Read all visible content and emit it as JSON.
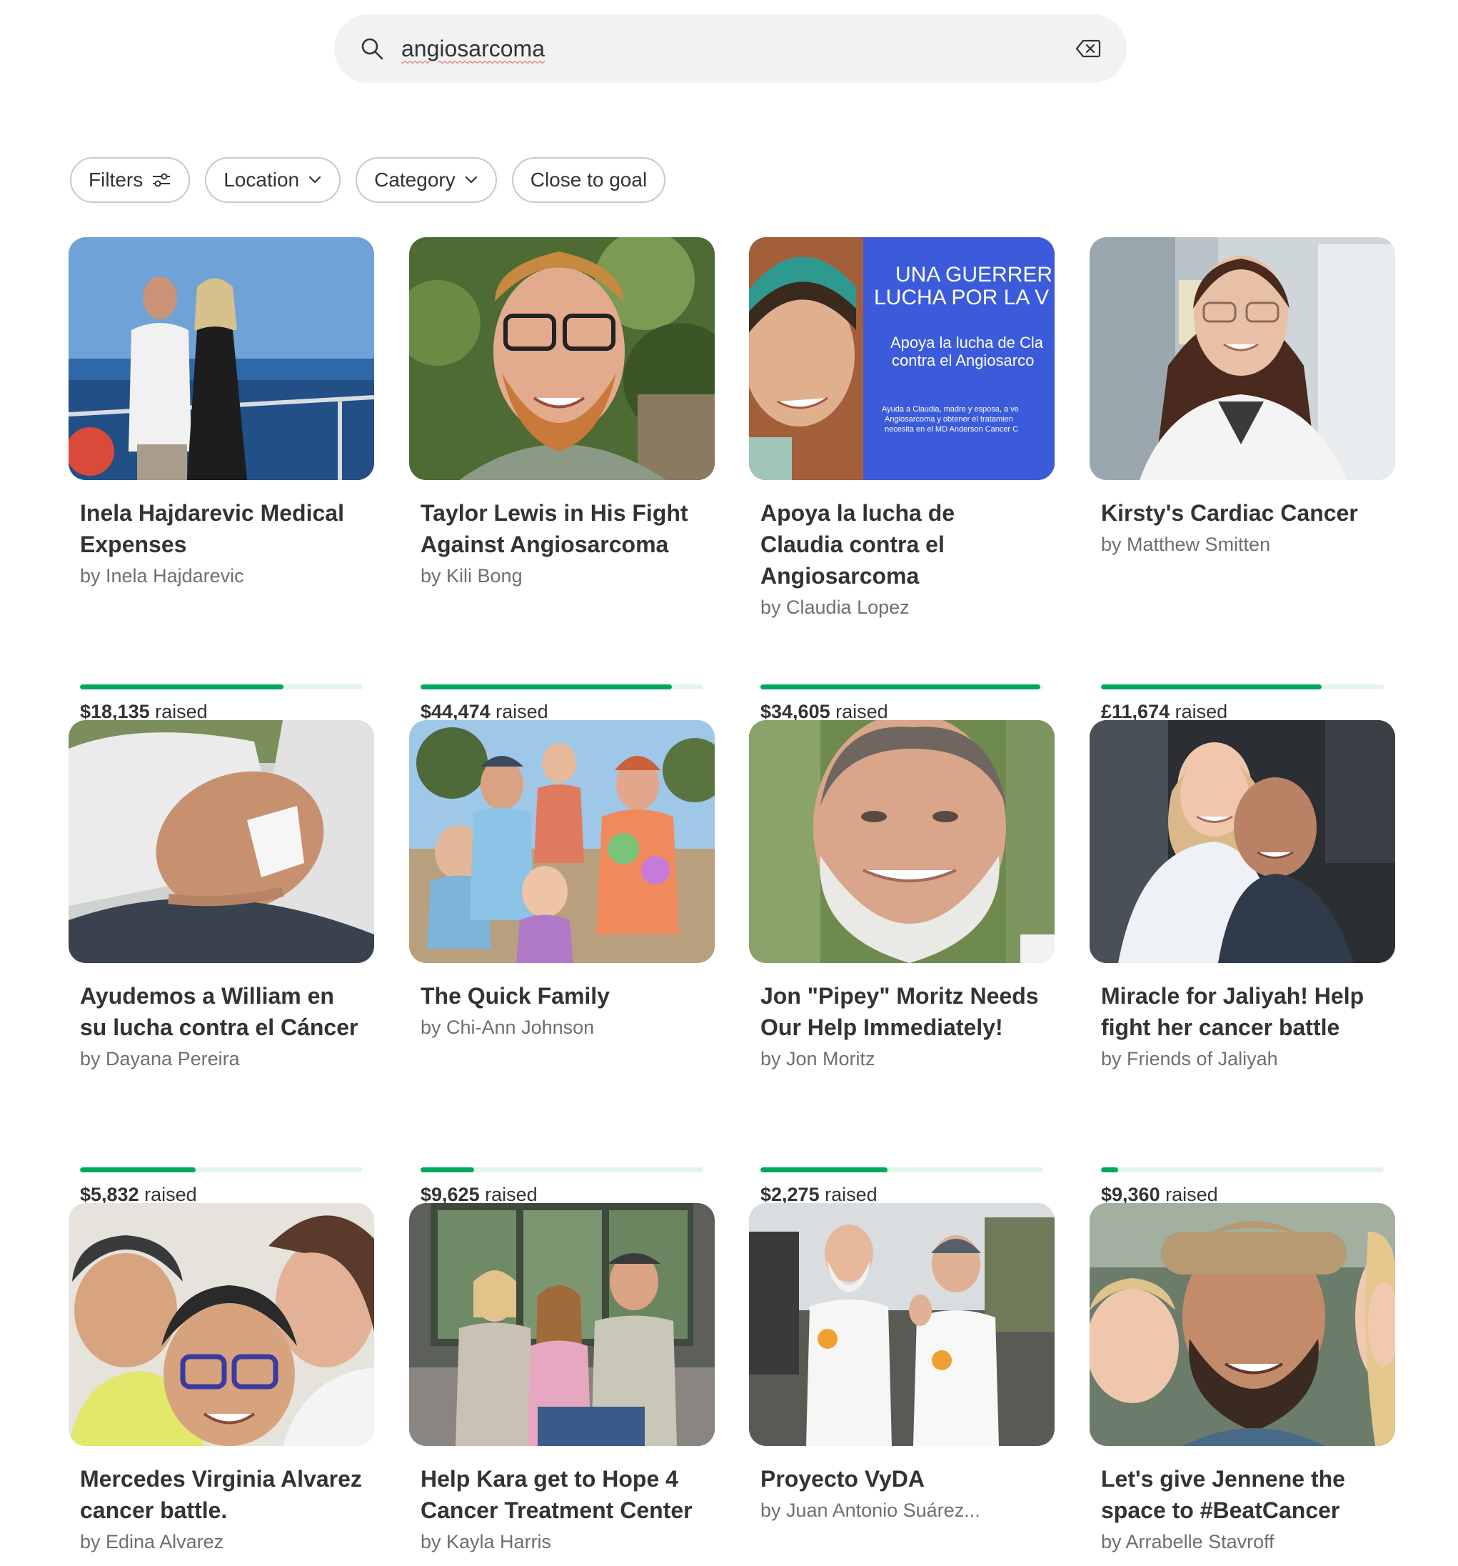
{
  "search": {
    "value": "angiosarcoma"
  },
  "filters": {
    "filters_label": "Filters",
    "location_label": "Location",
    "category_label": "Category",
    "close_to_goal_label": "Close to goal"
  },
  "raised_suffix": "raised",
  "fundraisers": [
    {
      "title": "Inela Hajdarevic Medical Expenses",
      "author": "by Inela Hajdarevic",
      "amount": "$18,135",
      "progress": 0.72
    },
    {
      "title": "Taylor Lewis in His Fight Against Angiosarcoma",
      "author": "by Kili Bong",
      "amount": "$44,474",
      "progress": 0.89
    },
    {
      "title": "Apoya la lucha de Claudia contra el Angiosarcoma",
      "author": "by Claudia Lopez",
      "amount": "$34,605",
      "progress": 0.99,
      "image_text": {
        "line1": "UNA GUERRER",
        "line2": "LUCHA POR LA V",
        "line3": "Apoya la lucha de Cla",
        "line4": "contra el Angiosarco",
        "line5": "Ayuda a Claudia, madre y esposa, a ve",
        "line6": "Angiosarcoma y obtener el tratamien",
        "line7": "necesita en el MD Anderson Cancer C"
      }
    },
    {
      "title": "Kirsty's Cardiac Cancer",
      "author": "by Matthew Smitten",
      "amount": "£11,674",
      "progress": 0.78
    },
    {
      "title": "Ayudemos a William en su lucha contra el Cáncer",
      "author": "by Dayana Pereira",
      "amount": "$5,832",
      "progress": 0.41
    },
    {
      "title": "The Quick Family",
      "author": "by Chi-Ann Johnson",
      "amount": "$9,625",
      "progress": 0.19
    },
    {
      "title": "Jon \"Pipey\" Moritz Needs Our Help Immediately!",
      "author": "by Jon Moritz",
      "amount": "$2,275",
      "progress": 0.45
    },
    {
      "title": "Miracle for Jaliyah! Help fight her cancer battle",
      "author": "by Friends of Jaliyah",
      "amount": "$9,360",
      "progress": 0.06
    },
    {
      "title": "Mercedes Virginia Alvarez cancer battle.",
      "author": "by Edina Alvarez"
    },
    {
      "title": "Help Kara get to Hope 4 Cancer Treatment Center",
      "author": "by Kayla Harris"
    },
    {
      "title": "Proyecto VyDA",
      "author": "by Juan Antonio Suárez..."
    },
    {
      "title": "Let's give Jennene the space to #BeatCancer",
      "author": "by Arrabelle Stavroff"
    }
  ]
}
